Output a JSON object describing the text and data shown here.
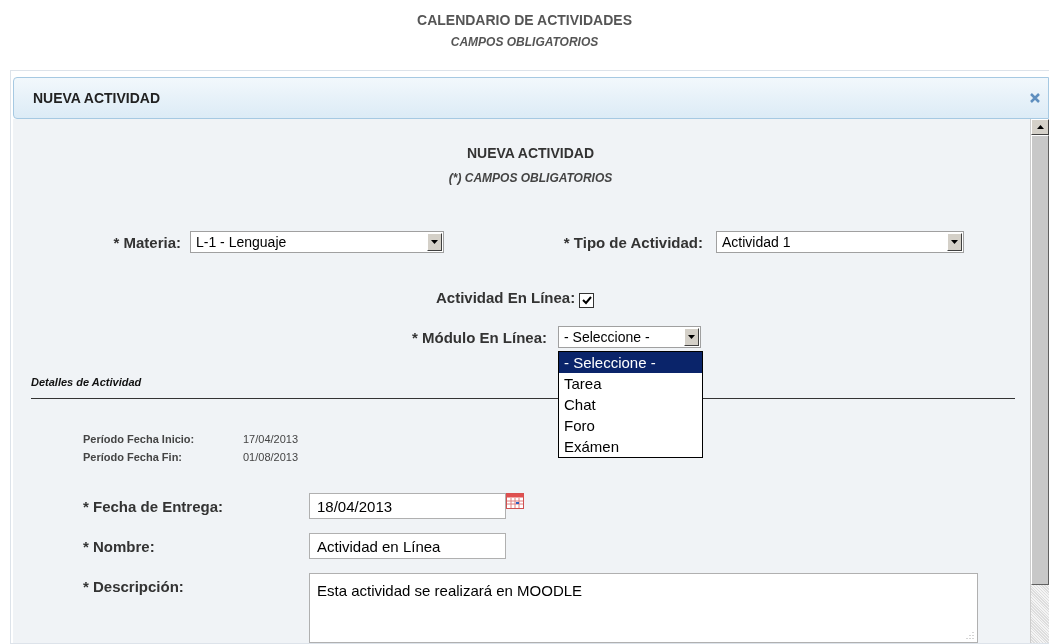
{
  "page_header": {
    "title": "CALENDARIO DE ACTIVIDADES",
    "subtitle": "CAMPOS OBLIGATORIOS"
  },
  "dialog": {
    "title": "NUEVA ACTIVIDAD"
  },
  "form": {
    "title": "NUEVA ACTIVIDAD",
    "subtitle": "(*) CAMPOS OBLIGATORIOS",
    "materia": {
      "label": "* Materia:",
      "value": "L-1 - Lenguaje"
    },
    "tipo": {
      "label": "* Tipo de Actividad:",
      "value": "Actividad 1"
    },
    "online": {
      "label": "Actividad En Línea:",
      "checked": true
    },
    "modulo": {
      "label": "* Módulo En Línea:",
      "value": "- Seleccione -",
      "expanded": true,
      "options": [
        {
          "label": "- Seleccione -",
          "selected": true
        },
        {
          "label": "Tarea",
          "selected": false
        },
        {
          "label": "Chat",
          "selected": false
        },
        {
          "label": "Foro",
          "selected": false
        },
        {
          "label": "Exámen",
          "selected": false
        }
      ]
    },
    "section_title": "Detalles de Actividad",
    "periods": [
      {
        "label": "Período Fecha Inicio:",
        "value": "17/04/2013"
      },
      {
        "label": "Período Fecha Fin:",
        "value": "01/08/2013"
      }
    ],
    "fields": [
      {
        "kind": "date",
        "label": "* Fecha de Entrega:",
        "value": "18/04/2013"
      },
      {
        "kind": "text",
        "label": "* Nombre:",
        "value": "Actividad en Línea"
      },
      {
        "kind": "textarea",
        "label": "* Descripción:",
        "value": "Esta actividad se realizará en MOODLE"
      }
    ]
  }
}
